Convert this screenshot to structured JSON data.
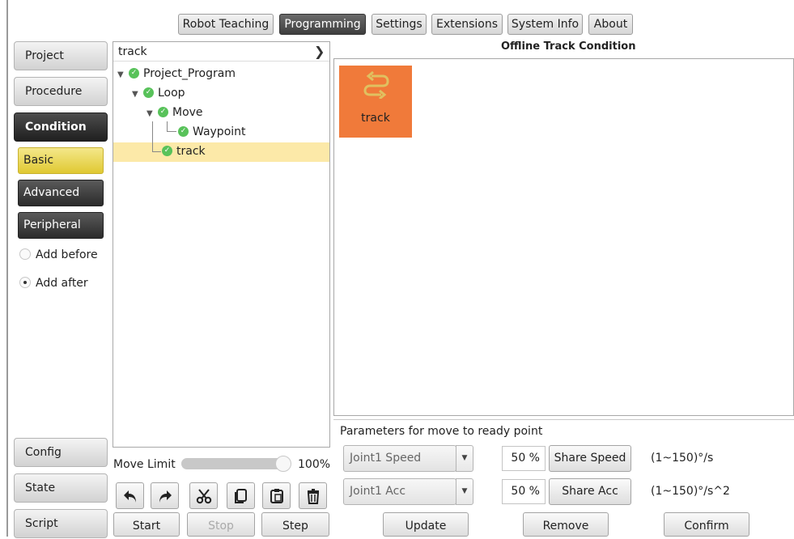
{
  "top_tabs": [
    {
      "label": "Robot Teaching",
      "active": false
    },
    {
      "label": "Programming",
      "active": true
    },
    {
      "label": "Settings",
      "active": false
    },
    {
      "label": "Extensions",
      "active": false
    },
    {
      "label": "System Info",
      "active": false
    },
    {
      "label": "About",
      "active": false
    }
  ],
  "sidebar": {
    "project": "Project",
    "procedure": "Procedure",
    "condition": "Condition",
    "basic": "Basic",
    "advanced": "Advanced",
    "peripheral": "Peripheral",
    "add_before": "Add before",
    "add_after": "Add after",
    "add_after_selected": true,
    "config": "Config",
    "state": "State",
    "script": "Script"
  },
  "tree": {
    "header": "track",
    "items": [
      {
        "label": "Project_Program",
        "expanded": true
      },
      {
        "label": "Loop",
        "expanded": true
      },
      {
        "label": "Move",
        "expanded": true
      },
      {
        "label": "Waypoint",
        "expanded": false
      },
      {
        "label": "track",
        "selected": true
      }
    ]
  },
  "move_limit": {
    "label": "Move Limit",
    "value_text": "100%",
    "fraction": 1.0
  },
  "bottom_left": {
    "start": "Start",
    "stop": "Stop",
    "step": "Step"
  },
  "main": {
    "title": "Offline Track Condition",
    "tile_label": "track",
    "tile_color": "#f07a3a",
    "params_title": "Parameters for move to ready point",
    "speed": {
      "select": "Joint1 Speed",
      "percent": "50 %",
      "button": "Share Speed",
      "range": "(1~150)°/s"
    },
    "acc": {
      "select": "Joint1 Acc",
      "percent": "50 %",
      "button": "Share Acc",
      "range": "(1~150)°/s^2"
    },
    "update": "Update",
    "remove": "Remove",
    "confirm": "Confirm"
  },
  "colors": {
    "accent_yellow": "#e8d548",
    "selected_row": "#fce9a8",
    "check_green": "#58c25a"
  }
}
